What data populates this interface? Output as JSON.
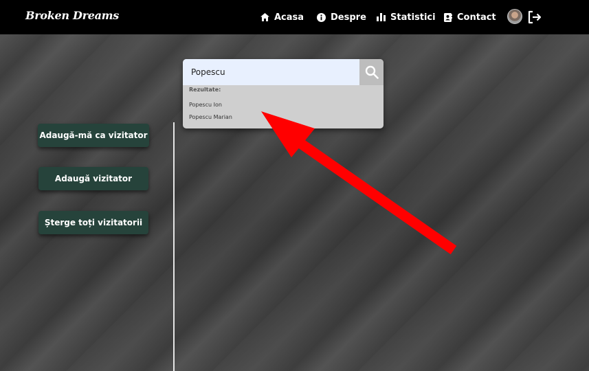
{
  "navbar": {
    "brand": "Broken Dreams",
    "items": [
      {
        "label": "Acasa",
        "icon": "home-icon"
      },
      {
        "label": "Despre",
        "icon": "info-icon"
      },
      {
        "label": "Statistici",
        "icon": "bar-chart-icon"
      },
      {
        "label": "Contact",
        "icon": "contact-card-icon"
      }
    ],
    "logout_icon": "logout-icon"
  },
  "search": {
    "value": "Popescu",
    "button_icon": "search-icon",
    "results_label": "Rezultate:",
    "results": [
      "Popescu Ion",
      "Popescu Marian"
    ]
  },
  "sidebar": {
    "buttons": [
      {
        "label": "Adaugă-mă ca vizitator"
      },
      {
        "label": "Adaugă vizitator"
      },
      {
        "label": "Șterge toți vizitatorii"
      }
    ]
  },
  "annotation": {
    "arrow_color": "#ff0000"
  }
}
